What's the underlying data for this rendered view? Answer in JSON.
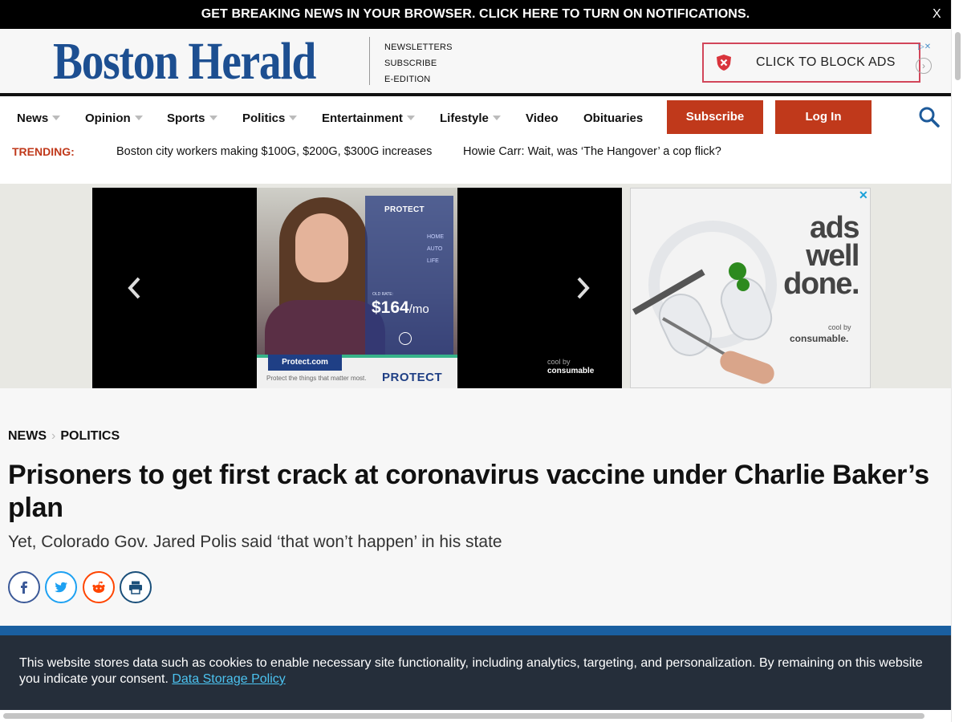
{
  "notification": {
    "text": "GET BREAKING NEWS IN YOUR BROWSER. CLICK HERE TO TURN ON NOTIFICATIONS.",
    "close": "X"
  },
  "masthead": {
    "logo": "Boston Herald",
    "links": [
      "NEWSLETTERS",
      "SUBSCRIBE",
      "E-EDITION"
    ],
    "block_ads": "CLICK TO BLOCK ADS",
    "block_ads_arrow": "›",
    "ad_choices": "▷✕"
  },
  "nav": {
    "items": [
      {
        "label": "News",
        "dropdown": true
      },
      {
        "label": "Opinion",
        "dropdown": true
      },
      {
        "label": "Sports",
        "dropdown": true
      },
      {
        "label": "Politics",
        "dropdown": true
      },
      {
        "label": "Entertainment",
        "dropdown": true
      },
      {
        "label": "Lifestyle",
        "dropdown": true
      },
      {
        "label": "Video",
        "dropdown": false
      },
      {
        "label": "Obituaries",
        "dropdown": false
      }
    ],
    "subscribe": "Subscribe",
    "login": "Log In",
    "search_icon": "search-icon"
  },
  "trending": {
    "label": "TRENDING:",
    "links": [
      "Boston city workers making $100G, $200G, $300G increases",
      "Howie Carr: Wait, was ‘The Hangover’ a cop flick?"
    ]
  },
  "video_ad": {
    "brand": "PROTECT",
    "menu": [
      "HOME",
      "AUTO",
      "LIFE"
    ],
    "old_rate": "OLD RATE:",
    "price": "$164",
    "per": "/mo",
    "site": "Protect.com",
    "tagline": "Protect the things that matter most.",
    "logo": "PROTECT",
    "cool_by": "cool by",
    "consumable": "consumable"
  },
  "side_ad": {
    "close": "✕",
    "lines": [
      "ads",
      "well",
      "done."
    ],
    "cool_by": "cool by",
    "brand": "consumable."
  },
  "article": {
    "breadcrumb": [
      "NEWS",
      "POLITICS"
    ],
    "headline": "Prisoners to get first crack at coronavirus vaccine under Charlie Baker’s plan",
    "subhead": "Yet, Colorado Gov. Jared Polis said ‘that won’t happen’ in his state",
    "share": [
      {
        "name": "facebook",
        "color": "#3b5998"
      },
      {
        "name": "twitter",
        "color": "#1da1f2"
      },
      {
        "name": "reddit",
        "color": "#ff4500"
      },
      {
        "name": "print",
        "color": "#1a4f7a"
      }
    ]
  },
  "cookie": {
    "text": "This website stores data such as cookies to enable necessary site functionality, including analytics, targeting, and personalization. By remaining on this website you indicate your consent.",
    "link": "Data Storage Policy"
  },
  "colors": {
    "brand_blue": "#1d4f91",
    "accent_red": "#c0391b",
    "cookie_bg": "#252e3a",
    "link_cyan": "#4cc3f0"
  }
}
